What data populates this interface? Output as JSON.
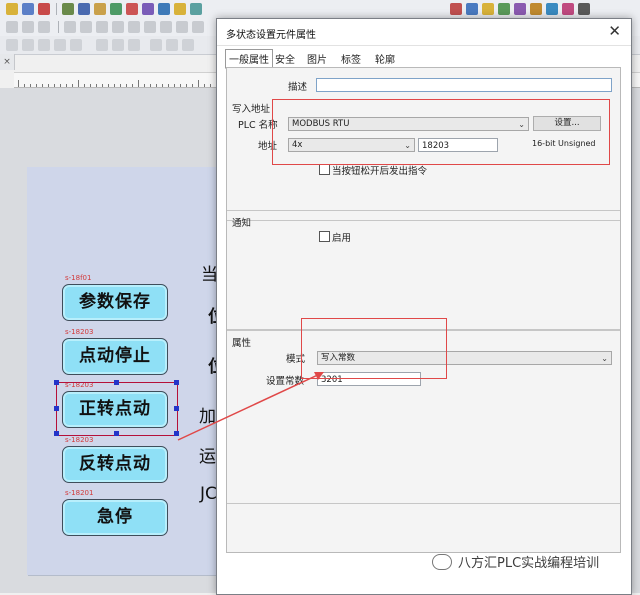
{
  "canvas": {
    "buttons": [
      {
        "label": "参数保存",
        "tag": "s-18f01"
      },
      {
        "label": "点动停止",
        "tag": "s-18203"
      },
      {
        "label": "正转点动",
        "tag": "s-18203"
      },
      {
        "label": "反转点动",
        "tag": "s-18203"
      },
      {
        "label": "急停",
        "tag": "s-18201"
      }
    ],
    "texts": [
      "当",
      "位",
      "位",
      "加",
      "运",
      "JC"
    ]
  },
  "dialog": {
    "title": "多状态设置元件属性",
    "tabs": [
      "一般属性",
      "安全",
      "图片",
      "标签",
      "轮廓"
    ],
    "description_label": "描述",
    "write_section": "写入地址",
    "plc_name_label": "PLC 名称",
    "plc_name_value": "MODBUS RTU",
    "settings_button": "设置...",
    "address_label": "地址",
    "address_type": "4x",
    "address_value": "18203",
    "data_type": "16-bit Unsigned",
    "release_checkbox_label": "当按钮松开后发出指令",
    "notify_section": "通知",
    "enable_checkbox_label": "启用",
    "attr_section": "属性",
    "mode_label": "模式",
    "mode_value": "写入常数",
    "const_label": "设置常数",
    "const_value": "3201"
  },
  "watermark": "八方汇PLC实战编程培训",
  "colors": {
    "button_fill": "#8fe0f6",
    "highlight_red": "#e04848",
    "selection": "#b5103a"
  }
}
